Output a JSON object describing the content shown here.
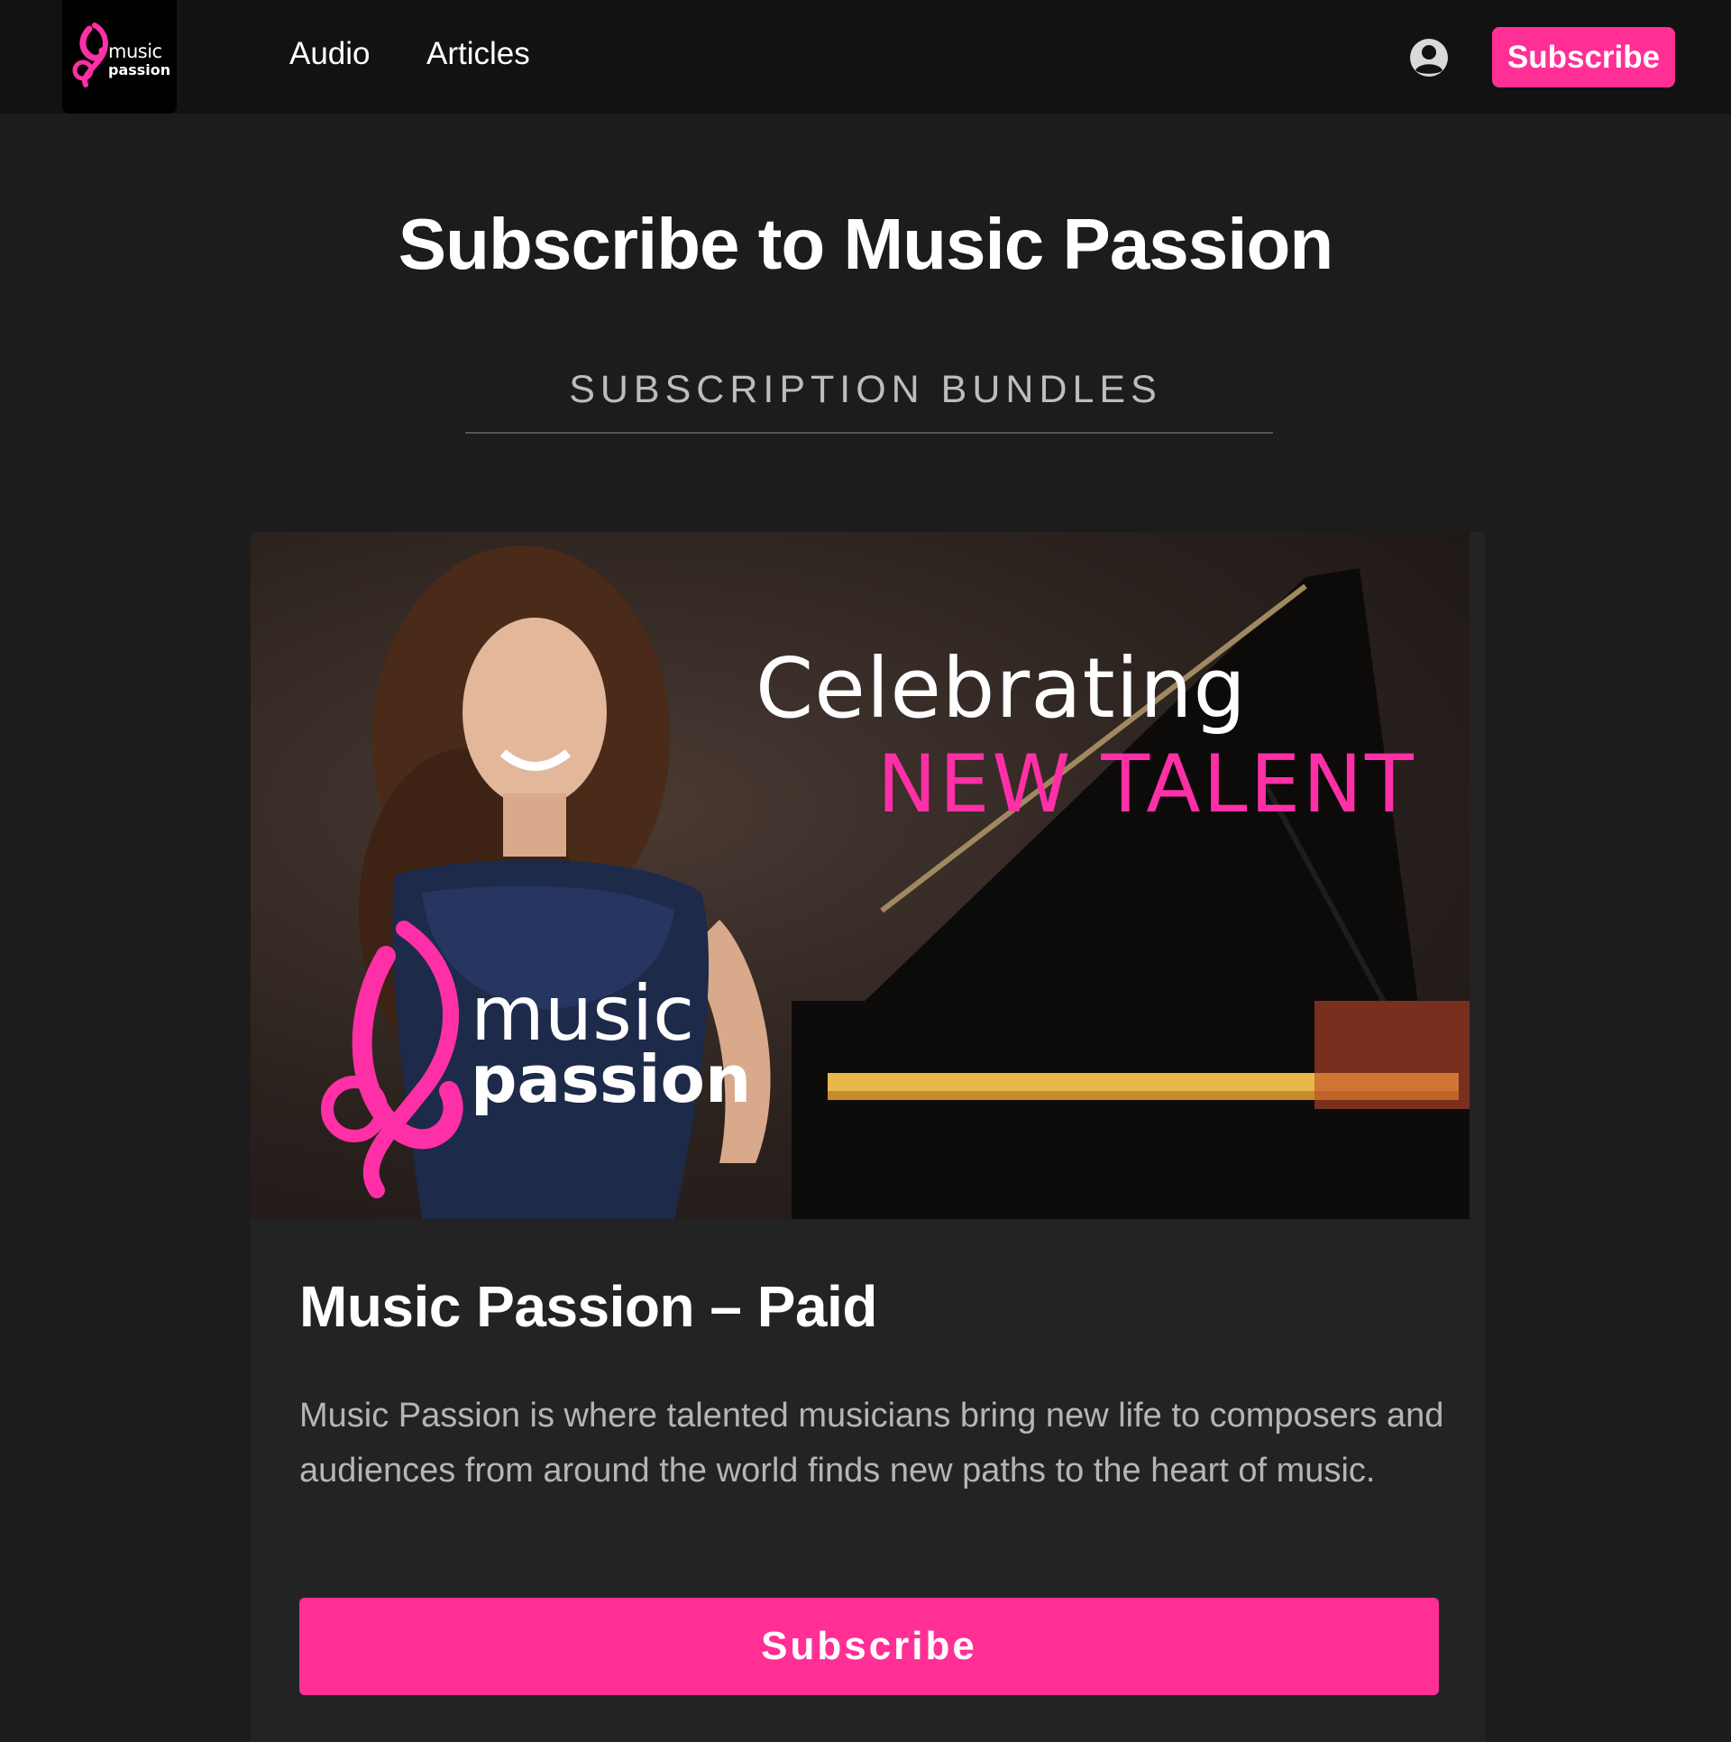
{
  "header": {
    "logo_icon": "music-passion-logo",
    "logo_line1": "music",
    "logo_line2": "passion",
    "nav": [
      {
        "label": "Audio"
      },
      {
        "label": "Articles"
      }
    ],
    "account_icon": "account-circle-icon",
    "subscribe_label": "Subscribe"
  },
  "main": {
    "title": "Subscribe to Music Passion",
    "section_label": "SUBSCRIPTION BUNDLES"
  },
  "bundle": {
    "banner": {
      "headline": "Celebrating",
      "tagline": "NEW TALENT",
      "logo_line1": "music",
      "logo_line2": "passion"
    },
    "title": "Music Passion – Paid",
    "description": "Music Passion is where talented musicians bring new life to composers and audiences from around the world finds new paths to the heart of music.",
    "subscribe_label": "Subscribe"
  },
  "colors": {
    "accent": "#ff2f96",
    "background": "#1c1c1c",
    "header": "#121212",
    "card": "#232323"
  }
}
